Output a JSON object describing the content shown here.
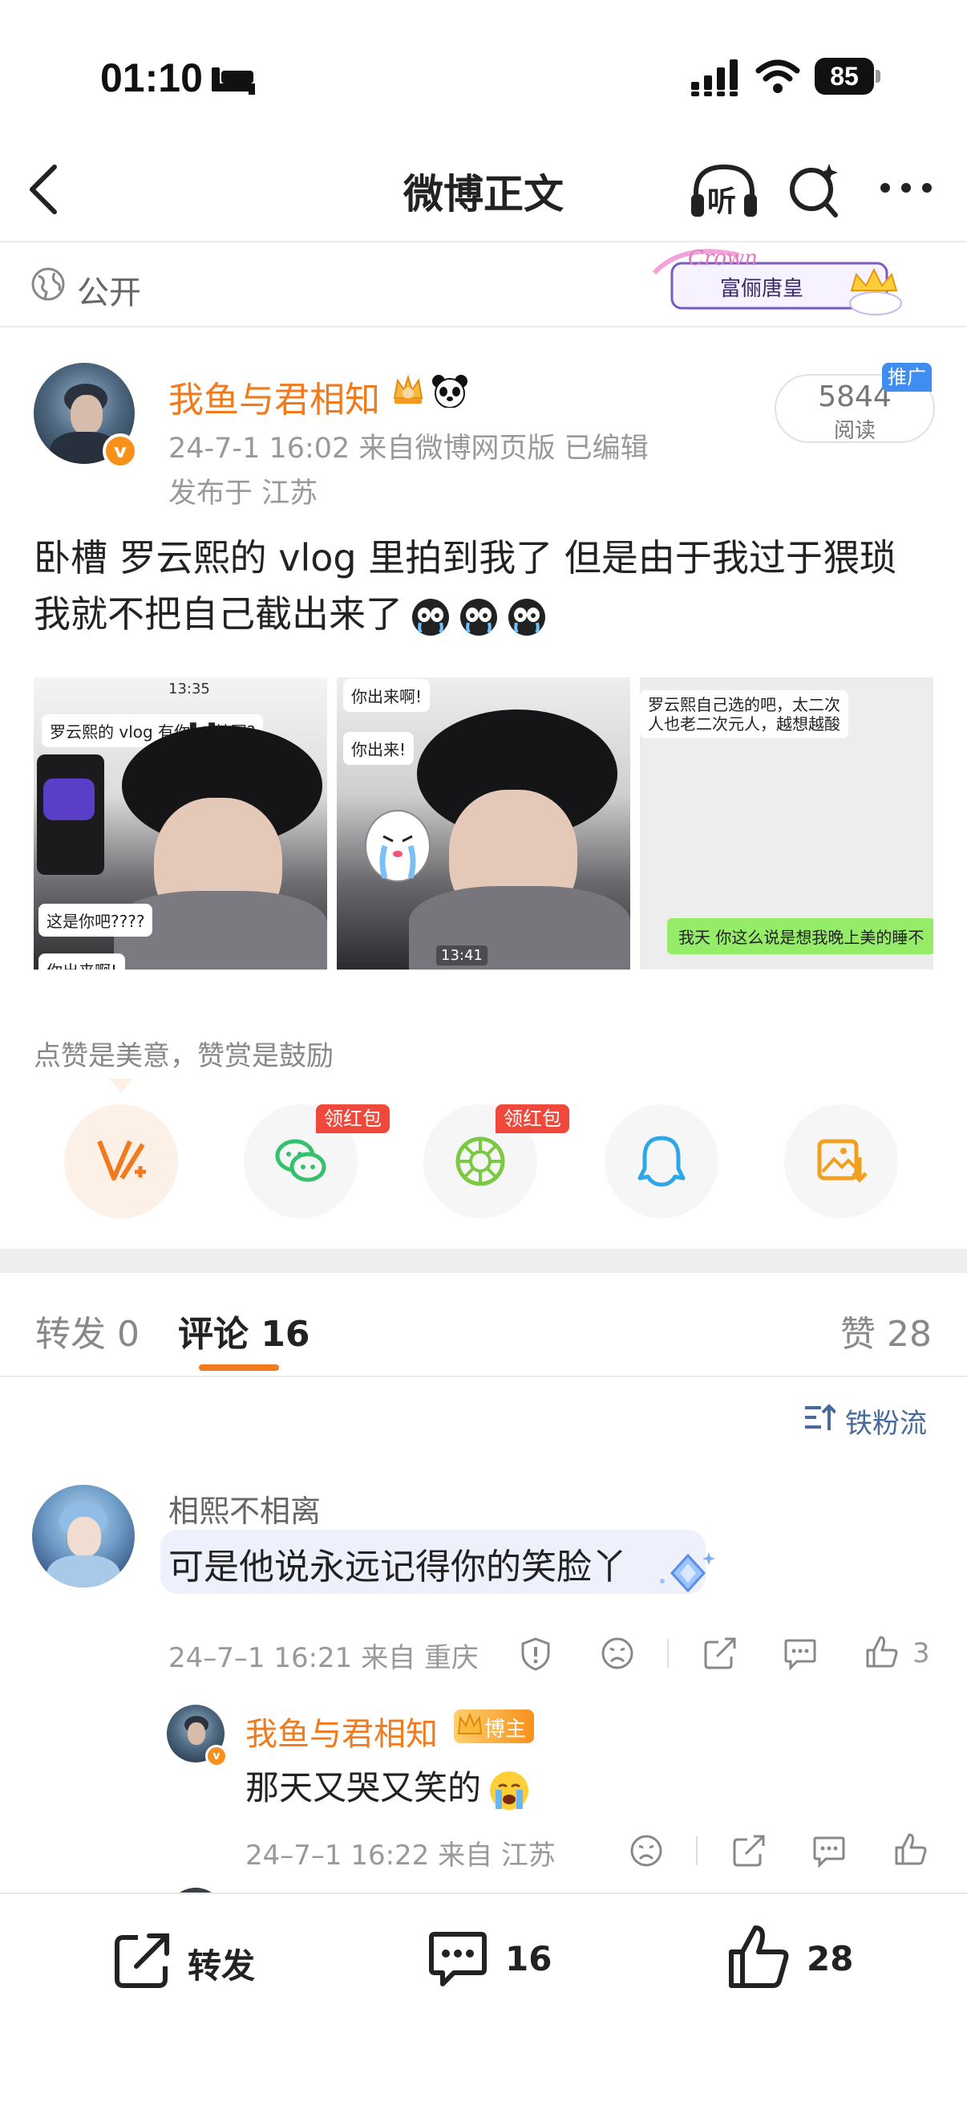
{
  "status_bar": {
    "time": "01:10",
    "battery": "85"
  },
  "nav": {
    "title": "微博正文",
    "listen_label": "听"
  },
  "visibility": {
    "label": "公开"
  },
  "post": {
    "author": "我鱼与君相知",
    "meta": "24-7-1 16:02  来自微博网页版  已编辑",
    "location": "发布于 江苏",
    "read_count": "5844",
    "read_label": "阅读",
    "promo_badge": "推广",
    "text_line1": "卧槽 罗云熙的 vlog 里拍到我了 但是由于我过于猥琐",
    "text_line2": "我就不把自己截出来了",
    "images": {
      "pic1": {
        "timestamp": "13:35",
        "bubble_top": "罗云熙的 vlog 有你▚▞特写?",
        "bubble_mid": "这是你吧????",
        "bubble_bottom": "你出来啊!"
      },
      "pic2": {
        "bubble_top": "你出来啊!",
        "bubble_mid": "你出来!",
        "timestamp": "13:41"
      },
      "pic3": {
        "bubble_top_line1": "罗云熙自己选的吧，太二次",
        "bubble_top_line2": "人也老二次元人，越想越酸",
        "bubble_green": "我天 你这么说是想我晚上美的睡不"
      }
    }
  },
  "support": {
    "text": "点赞是美意，赞赏是鼓励",
    "red_tag": "领红包",
    "icons": [
      "vplus-icon",
      "wechat-icon",
      "moments-icon",
      "qq-icon",
      "save-image-icon"
    ]
  },
  "tabs": {
    "forward": "转发 0",
    "comment": "评论 16",
    "like": "赞 28"
  },
  "sort": {
    "label": "铁粉流"
  },
  "comments": [
    {
      "name": "相熙不相离",
      "text": "可是他说永远记得你的笑脸丫",
      "meta": "24–7–1 16:21  来自 重庆",
      "likes": "3"
    }
  ],
  "reply": {
    "name": "我鱼与君相知",
    "tag": "博主",
    "text": "那天又哭又笑的",
    "meta": "24–7–1 16:22  来自 江苏"
  },
  "bottom_bar": {
    "forward": "转发",
    "comment_count": "16",
    "like_count": "28"
  },
  "colors": {
    "accent": "#f07a1e",
    "link": "#4a6a9c",
    "red": "#f0483a"
  }
}
